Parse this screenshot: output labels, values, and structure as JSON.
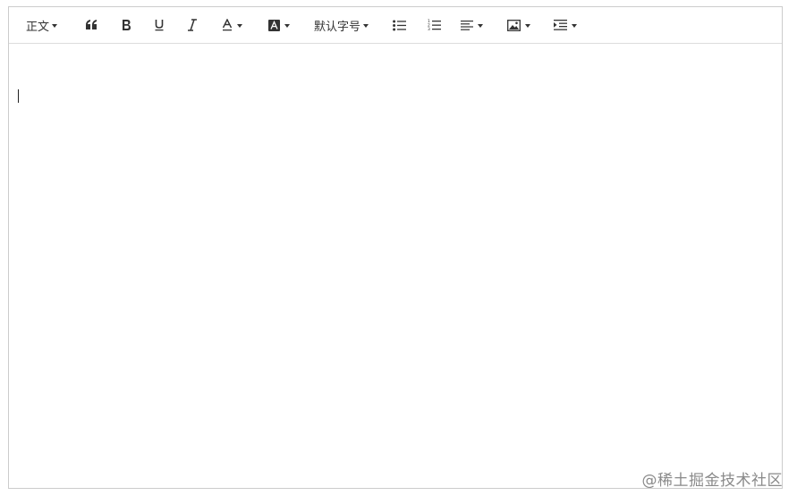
{
  "toolbar": {
    "heading_label": "正文",
    "font_size_label": "默认字号"
  },
  "editor": {
    "content": ""
  },
  "watermark": "@稀土掘金技术社区"
}
